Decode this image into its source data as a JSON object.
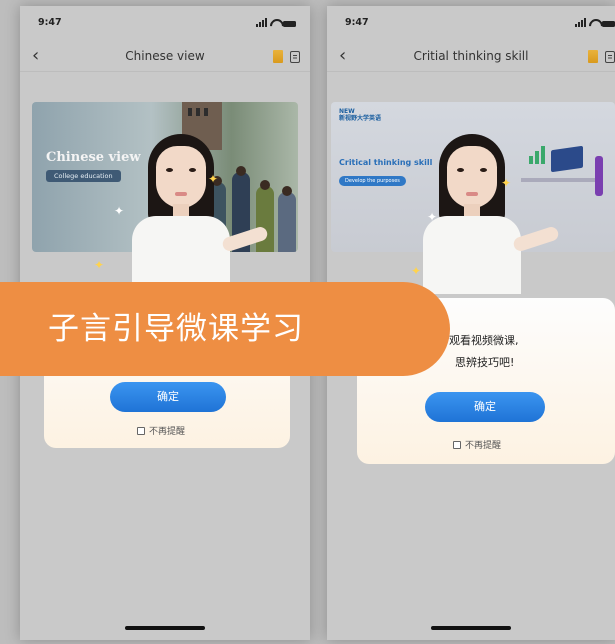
{
  "left_phone": {
    "status": {
      "time": "9:47"
    },
    "nav": {
      "back_icon": "chevron-left",
      "title": "Chinese view",
      "icons": [
        "book-icon",
        "document-icon"
      ]
    },
    "banner": {
      "title": "Chinese view",
      "tag": "College education"
    },
    "dialog": {
      "confirm_label": "确定",
      "dont_remind_label": "不再提醒"
    }
  },
  "right_phone": {
    "status": {
      "time": "9:47"
    },
    "nav": {
      "back_icon": "chevron-left",
      "title": "Critial thinking skill",
      "icons": [
        "book-icon",
        "document-icon"
      ]
    },
    "banner": {
      "logo_line1": "NEW",
      "logo_line2": "新视野大学英语",
      "title": "Critical thinking skill",
      "tag": "Develop the purposes"
    },
    "dialog": {
      "line1": "观看视频微课,",
      "line2": "思辨技巧吧!",
      "confirm_label": "确定",
      "dont_remind_label": "不再提醒"
    }
  },
  "overlay": {
    "caption": "子言引导微课学习"
  },
  "colors": {
    "accent_orange": "#ee8e43",
    "button_blue": "#2a84e6",
    "brand_gold": "#e0a62d"
  }
}
